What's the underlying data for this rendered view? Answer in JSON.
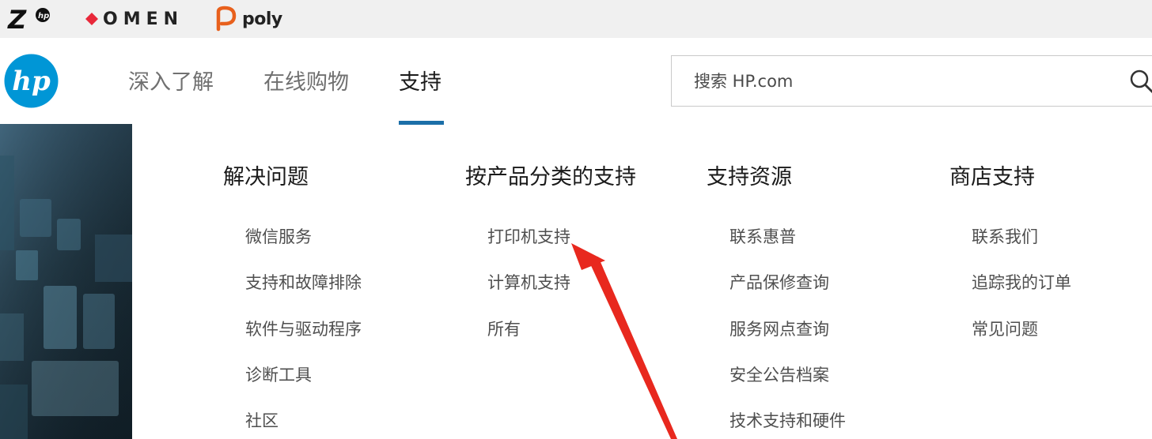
{
  "brand_strip": {
    "z_logo_text": "Z",
    "omen_logo_text": "OMEN",
    "poly_logo_text": "poly"
  },
  "header": {
    "logo_text": "hp",
    "nav": [
      {
        "label": "深入了解",
        "active": false
      },
      {
        "label": "在线购物",
        "active": false
      },
      {
        "label": "支持",
        "active": true
      }
    ],
    "search": {
      "placeholder": "搜索 HP.com",
      "value": ""
    }
  },
  "menu": {
    "columns": [
      {
        "title": "解决问题",
        "links": [
          "微信服务",
          "支持和故障排除",
          "软件与驱动程序",
          "诊断工具",
          "社区"
        ]
      },
      {
        "title": "按产品分类的支持",
        "links": [
          "打印机支持",
          "计算机支持",
          "所有"
        ]
      },
      {
        "title": "支持资源",
        "links": [
          "联系惠普",
          "产品保修查询",
          "服务网点查询",
          "安全公告档案",
          "技术支持和硬件"
        ]
      },
      {
        "title": "商店支持",
        "links": [
          "联系我们",
          "追踪我的订单",
          "常见问题"
        ]
      }
    ]
  },
  "colors": {
    "hp_blue": "#0096d6",
    "nav_underline": "#1b6fa8",
    "annotation_arrow": "#e8281e",
    "omen_red": "#e8283a",
    "poly_orange": "#e8601c"
  },
  "icons": {
    "search": "search-icon",
    "annotation": "red-arrow-annotation"
  }
}
